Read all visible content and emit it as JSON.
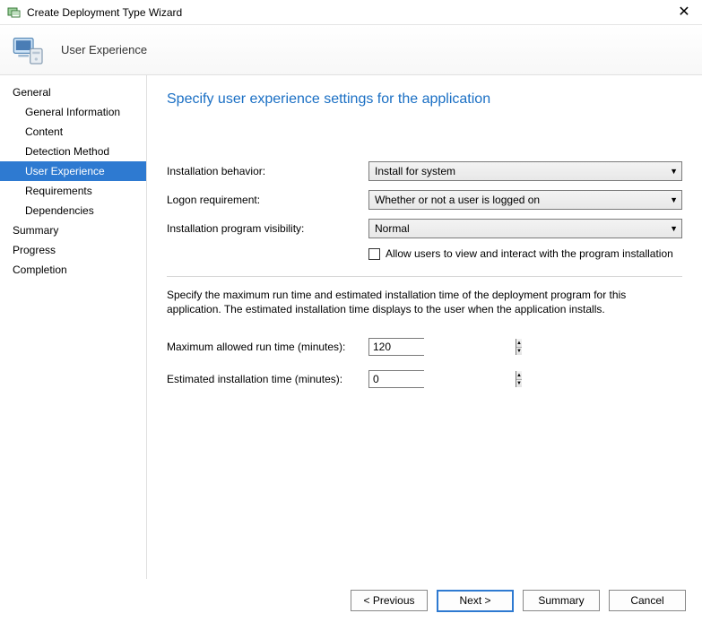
{
  "window": {
    "title": "Create Deployment Type Wizard"
  },
  "header": {
    "title": "User Experience"
  },
  "sidebar": {
    "items": [
      {
        "label": "General",
        "sub": false
      },
      {
        "label": "General Information",
        "sub": true
      },
      {
        "label": "Content",
        "sub": true
      },
      {
        "label": "Detection Method",
        "sub": true
      },
      {
        "label": "User Experience",
        "sub": true,
        "active": true
      },
      {
        "label": "Requirements",
        "sub": true
      },
      {
        "label": "Dependencies",
        "sub": true
      },
      {
        "label": "Summary",
        "sub": false
      },
      {
        "label": "Progress",
        "sub": false
      },
      {
        "label": "Completion",
        "sub": false
      }
    ]
  },
  "content": {
    "heading": "Specify user experience settings for the application",
    "install_behavior_label": "Installation behavior:",
    "install_behavior_value": "Install for system",
    "logon_req_label": "Logon requirement:",
    "logon_req_value": "Whether or not a user is logged on",
    "visibility_label": "Installation program visibility:",
    "visibility_value": "Normal",
    "allow_interact_label": "Allow users to view and interact with the program installation",
    "description": "Specify the maximum run time and estimated installation time of the deployment program for this application. The estimated installation time displays to the user when the application installs.",
    "max_runtime_label": "Maximum allowed run time (minutes):",
    "max_runtime_value": "120",
    "est_time_label": "Estimated installation time (minutes):",
    "est_time_value": "0"
  },
  "footer": {
    "previous": "< Previous",
    "next": "Next >",
    "summary": "Summary",
    "cancel": "Cancel"
  }
}
